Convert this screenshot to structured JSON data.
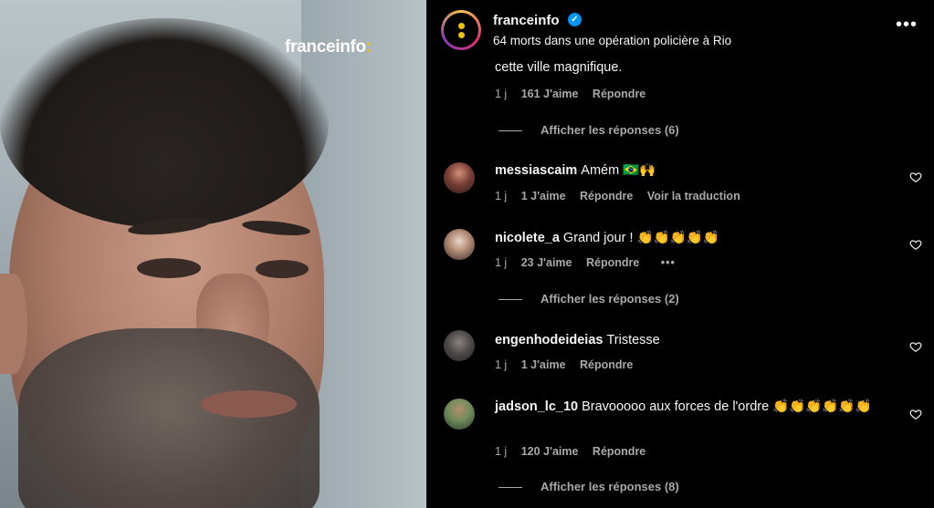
{
  "media": {
    "watermark": "franceinfo",
    "watermark_colon": ":"
  },
  "header": {
    "account_name": "franceinfo",
    "verified_mark": "✓",
    "subtitle": "64 morts dans une opération policière à Rio",
    "more_label": "•••"
  },
  "previous_comment": {
    "text_tail": "cette ville magnifique.",
    "time": "1 j",
    "likes": "161 J'aime",
    "reply": "Répondre",
    "view_replies": "Afficher les réponses (6)"
  },
  "comments": [
    {
      "username": "messiascaim",
      "text": "Amém 🇧🇷🙌",
      "time": "1 j",
      "likes": "1 J'aime",
      "reply": "Répondre",
      "translate": "Voir la traduction"
    },
    {
      "username": "nicolete_a",
      "text": "Grand jour ! 👏👏👏👏👏",
      "time": "1 j",
      "likes": "23 J'aime",
      "reply": "Répondre",
      "options": "•••",
      "view_replies": "Afficher les réponses (2)"
    },
    {
      "username": "engenhodeideias",
      "text": "Tristesse",
      "time": "1 j",
      "likes": "1 J'aime",
      "reply": "Répondre"
    },
    {
      "username": "jadson_lc_10",
      "text": "Bravooooo aux forces de l'ordre 👏👏👏👏👏👏",
      "time": "1 j",
      "likes": "120 J'aime",
      "reply": "Répondre",
      "view_replies": "Afficher les réponses (8)"
    }
  ],
  "icons": {
    "heart": "heart-icon",
    "verified": "verified-badge-icon",
    "more": "more-options-icon"
  },
  "colors": {
    "background": "#000000",
    "text_primary": "#f5f5f5",
    "text_secondary": "#a8a8a8",
    "verified_blue": "#0095f6",
    "brand_yellow": "#f2c200"
  }
}
